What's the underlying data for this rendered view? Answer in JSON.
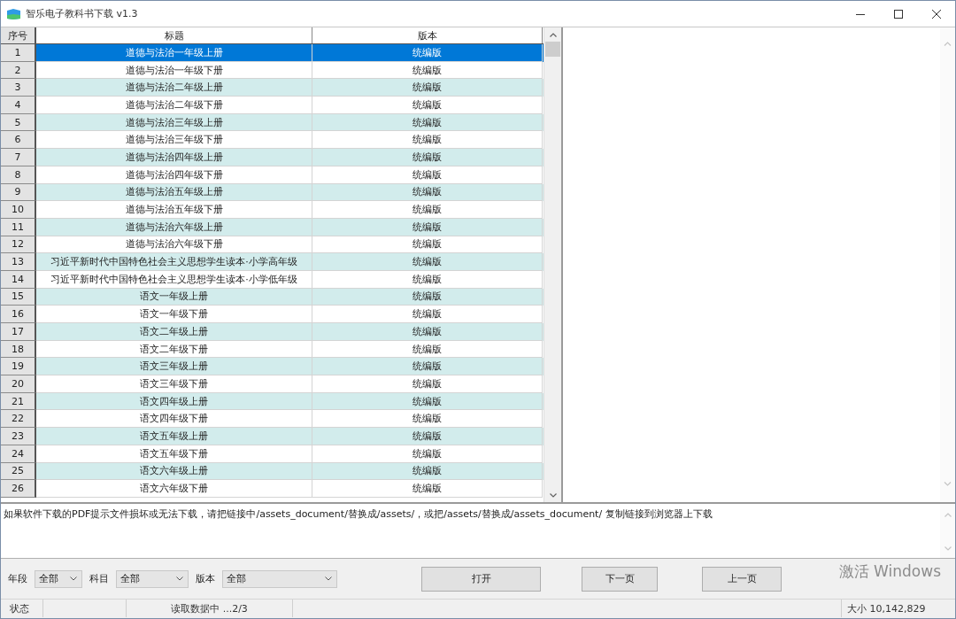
{
  "window": {
    "title": "智乐电子教科书下载 v1.3"
  },
  "table": {
    "columns": [
      "序号",
      "标题",
      "版本"
    ],
    "rows": [
      {
        "no": "1",
        "title": "道德与法治一年级上册",
        "edition": "统编版",
        "selected": true
      },
      {
        "no": "2",
        "title": "道德与法治一年级下册",
        "edition": "统编版",
        "selected": false
      },
      {
        "no": "3",
        "title": "道德与法治二年级上册",
        "edition": "统编版",
        "selected": false
      },
      {
        "no": "4",
        "title": "道德与法治二年级下册",
        "edition": "统编版",
        "selected": false
      },
      {
        "no": "5",
        "title": "道德与法治三年级上册",
        "edition": "统编版",
        "selected": false
      },
      {
        "no": "6",
        "title": "道德与法治三年级下册",
        "edition": "统编版",
        "selected": false
      },
      {
        "no": "7",
        "title": "道德与法治四年级上册",
        "edition": "统编版",
        "selected": false
      },
      {
        "no": "8",
        "title": "道德与法治四年级下册",
        "edition": "统编版",
        "selected": false
      },
      {
        "no": "9",
        "title": "道德与法治五年级上册",
        "edition": "统编版",
        "selected": false
      },
      {
        "no": "10",
        "title": "道德与法治五年级下册",
        "edition": "统编版",
        "selected": false
      },
      {
        "no": "11",
        "title": "道德与法治六年级上册",
        "edition": "统编版",
        "selected": false
      },
      {
        "no": "12",
        "title": "道德与法治六年级下册",
        "edition": "统编版",
        "selected": false
      },
      {
        "no": "13",
        "title": "习近平新时代中国特色社会主义思想学生读本·小学高年级",
        "edition": "统编版",
        "selected": false
      },
      {
        "no": "14",
        "title": "习近平新时代中国特色社会主义思想学生读本·小学低年级",
        "edition": "统编版",
        "selected": false
      },
      {
        "no": "15",
        "title": "语文一年级上册",
        "edition": "统编版",
        "selected": false
      },
      {
        "no": "16",
        "title": "语文一年级下册",
        "edition": "统编版",
        "selected": false
      },
      {
        "no": "17",
        "title": "语文二年级上册",
        "edition": "统编版",
        "selected": false
      },
      {
        "no": "18",
        "title": "语文二年级下册",
        "edition": "统编版",
        "selected": false
      },
      {
        "no": "19",
        "title": "语文三年级上册",
        "edition": "统编版",
        "selected": false
      },
      {
        "no": "20",
        "title": "语文三年级下册",
        "edition": "统编版",
        "selected": false
      },
      {
        "no": "21",
        "title": "语文四年级上册",
        "edition": "统编版",
        "selected": false
      },
      {
        "no": "22",
        "title": "语文四年级下册",
        "edition": "统编版",
        "selected": false
      },
      {
        "no": "23",
        "title": "语文五年级上册",
        "edition": "统编版",
        "selected": false
      },
      {
        "no": "24",
        "title": "语文五年级下册",
        "edition": "统编版",
        "selected": false
      },
      {
        "no": "25",
        "title": "语文六年级上册",
        "edition": "统编版",
        "selected": false
      },
      {
        "no": "26",
        "title": "语文六年级下册",
        "edition": "统编版",
        "selected": false
      }
    ]
  },
  "notice": {
    "text": "如果软件下载的PDF提示文件损坏或无法下载，请把链接中/assets_document/替换成/assets/，或把/assets/替换成/assets_document/ 复制链接到浏览器上下载"
  },
  "filters": [
    {
      "label": "年段",
      "value": "全部"
    },
    {
      "label": "科目",
      "value": "全部"
    },
    {
      "label": "版本",
      "value": "全部"
    }
  ],
  "buttons": [
    "打开",
    "下一页",
    "上一页"
  ],
  "activation_notice": {
    "text": "激活 Windows"
  },
  "status_bar": {
    "label": "状态",
    "message": "读取数据中 ...2/3",
    "size": "大小 10,142,829"
  }
}
